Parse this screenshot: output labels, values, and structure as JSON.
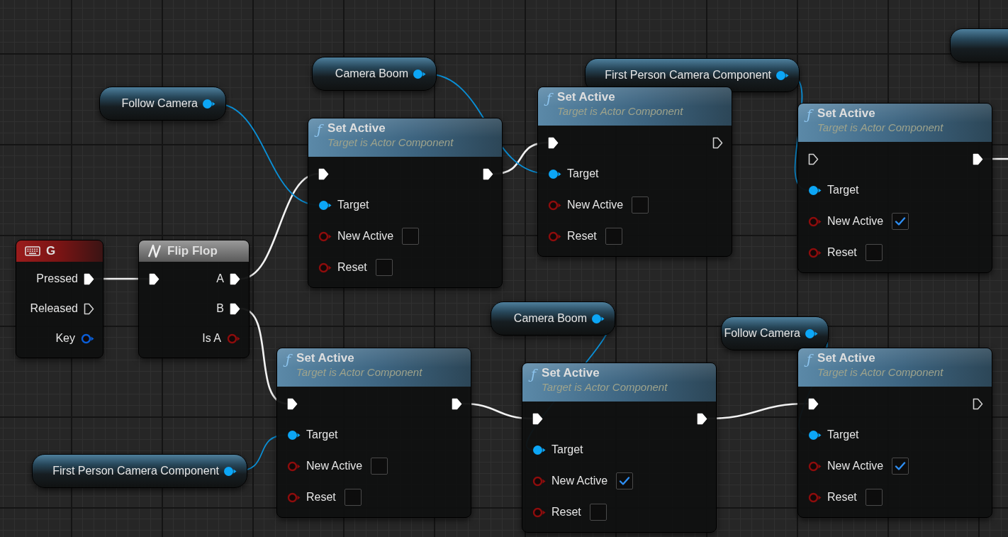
{
  "graph": {
    "nodes": [
      {
        "kind": "variable"
      },
      {
        "kind": "variable",
        "label": "Camera Boom",
        "pin": {
          "kind": "object",
          "connected": true
        }
      },
      {
        "kind": "variable",
        "label": "First Person Camera Component",
        "pin": {
          "kind": "object",
          "connected": true
        }
      },
      {
        "kind": "variable",
        "label": "Follow Camera",
        "pin": {
          "kind": "object",
          "connected": true
        }
      },
      {
        "kind": "function",
        "icon": "ƒ",
        "title": "Set Active",
        "subtitle": "Target is Actor Component",
        "inputs": [
          {
            "kind": "exec",
            "connected": true
          },
          {
            "kind": "object",
            "label": "Target",
            "connected": true
          },
          {
            "kind": "bool",
            "label": "New Active",
            "connected": false,
            "checked": false
          },
          {
            "kind": "bool",
            "label": "Reset",
            "connected": false,
            "checked": false
          }
        ],
        "outputs": [
          {
            "kind": "exec",
            "connected": true
          }
        ]
      },
      {
        "kind": "function",
        "icon": "ƒ",
        "title": "Set Active",
        "subtitle": "Target is Actor Component",
        "inputs": [
          {
            "kind": "exec",
            "connected": true
          },
          {
            "kind": "object",
            "label": "Target",
            "connected": true
          },
          {
            "kind": "bool",
            "label": "New Active",
            "connected": false,
            "checked": false
          },
          {
            "kind": "bool",
            "label": "Reset",
            "connected": false,
            "checked": false
          }
        ],
        "outputs": [
          {
            "kind": "exec",
            "connected": false
          }
        ]
      },
      {
        "kind": "function",
        "icon": "ƒ",
        "title": "Set Active",
        "subtitle": "Target is Actor Component",
        "inputs": [
          {
            "kind": "exec",
            "connected": false
          },
          {
            "kind": "object",
            "label": "Target",
            "connected": true
          },
          {
            "kind": "bool",
            "label": "New Active",
            "connected": false,
            "checked": true
          },
          {
            "kind": "bool",
            "label": "Reset",
            "connected": false,
            "checked": false
          }
        ],
        "outputs": [
          {
            "kind": "exec",
            "connected": true
          }
        ]
      },
      {
        "kind": "event",
        "title": "G",
        "outputs": [
          {
            "kind": "exec",
            "label": "Pressed",
            "connected": true
          },
          {
            "kind": "exec",
            "label": "Released",
            "connected": false
          },
          {
            "kind": "struct",
            "label": "Key",
            "connected": false
          }
        ]
      },
      {
        "kind": "macro",
        "title": "Flip Flop",
        "inputs": [
          {
            "kind": "exec",
            "connected": true
          }
        ],
        "outputs": [
          {
            "kind": "exec",
            "label": "A",
            "connected": true
          },
          {
            "kind": "exec",
            "label": "B",
            "connected": true
          },
          {
            "kind": "bool",
            "label": "Is A",
            "connected": false
          }
        ]
      },
      {
        "kind": "variable",
        "label": "Camera Boom",
        "pin": {
          "kind": "object",
          "connected": true
        }
      },
      {
        "kind": "variable",
        "label": "Follow Camera",
        "pin": {
          "kind": "object",
          "connected": true
        }
      },
      {
        "kind": "function",
        "icon": "ƒ",
        "title": "Set Active",
        "subtitle": "Target is Actor Component",
        "inputs": [
          {
            "kind": "exec",
            "connected": true
          },
          {
            "kind": "object",
            "label": "Target",
            "connected": true
          },
          {
            "kind": "bool",
            "label": "New Active",
            "connected": false,
            "checked": false
          },
          {
            "kind": "bool",
            "label": "Reset",
            "connected": false,
            "checked": false
          }
        ],
        "outputs": [
          {
            "kind": "exec",
            "connected": true
          }
        ]
      },
      {
        "kind": "function",
        "icon": "ƒ",
        "title": "Set Active",
        "subtitle": "Target is Actor Component",
        "inputs": [
          {
            "kind": "exec",
            "connected": true
          },
          {
            "kind": "object",
            "label": "Target",
            "connected": true
          },
          {
            "kind": "bool",
            "label": "New Active",
            "connected": false,
            "checked": true
          },
          {
            "kind": "bool",
            "label": "Reset",
            "connected": false,
            "checked": false
          }
        ],
        "outputs": [
          {
            "kind": "exec",
            "connected": true
          }
        ]
      },
      {
        "kind": "function",
        "icon": "ƒ",
        "title": "Set Active",
        "subtitle": "Target is Actor Component",
        "inputs": [
          {
            "kind": "exec",
            "connected": true
          },
          {
            "kind": "object",
            "label": "Target",
            "connected": true
          },
          {
            "kind": "bool",
            "label": "New Active",
            "connected": false,
            "checked": true
          },
          {
            "kind": "bool",
            "label": "Reset",
            "connected": false,
            "checked": false
          }
        ],
        "outputs": [
          {
            "kind": "exec",
            "connected": false
          }
        ]
      },
      {
        "kind": "variable",
        "label": "First Person Camera Component",
        "pin": {
          "kind": "object",
          "connected": true
        }
      }
    ]
  }
}
